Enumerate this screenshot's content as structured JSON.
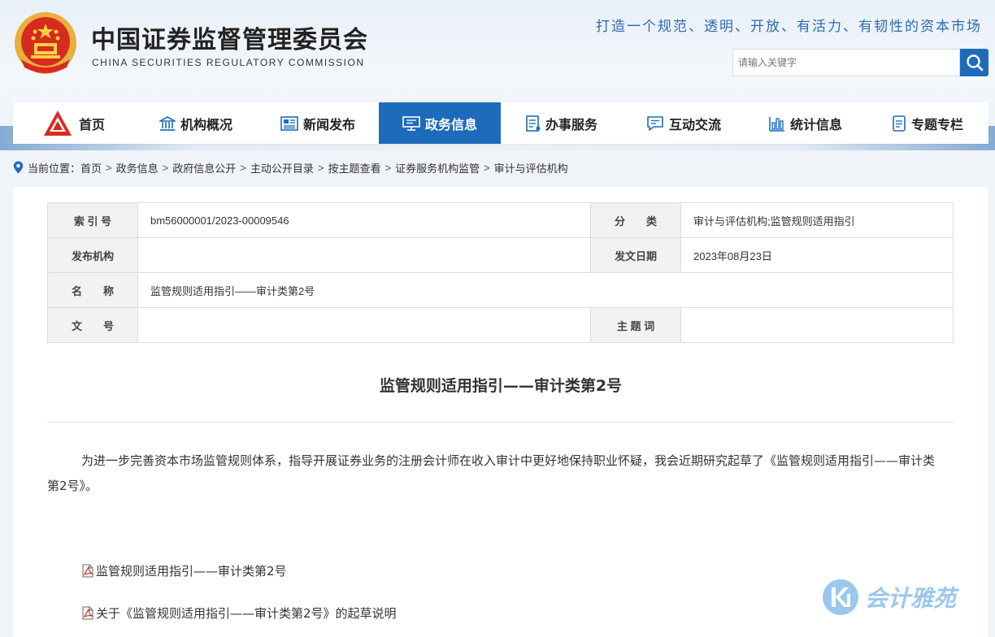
{
  "header": {
    "title": "中国证券监督管理委员会",
    "subtitle": "CHINA SECURITIES REGULATORY COMMISSION",
    "slogan": "打造一个规范、透明、开放、有活力、有韧性的资本市场",
    "search_placeholder": "请输入关键字"
  },
  "nav": {
    "items": [
      {
        "label": "首页",
        "icon": "csrc-logo-icon"
      },
      {
        "label": "机构概况",
        "icon": "building-icon"
      },
      {
        "label": "新闻发布",
        "icon": "newspaper-icon"
      },
      {
        "label": "政务信息",
        "icon": "monitor-icon",
        "active": true
      },
      {
        "label": "办事服务",
        "icon": "list-document-icon"
      },
      {
        "label": "互动交流",
        "icon": "chat-icon"
      },
      {
        "label": "统计信息",
        "icon": "bar-chart-icon"
      },
      {
        "label": "专题专栏",
        "icon": "document-icon"
      }
    ],
    "active_color": "#1f6bbb"
  },
  "breadcrumb": {
    "prefix": "当前位置：",
    "items": [
      "首页",
      "政务信息",
      "政府信息公开",
      "主动公开目录",
      "按主题查看",
      "证券服务机构监管",
      "审计与评估机构"
    ]
  },
  "meta": {
    "index_label": "索 引 号",
    "index_value": "bm56000001/2023-00009546",
    "category_label": "分　　类",
    "category_value": "审计与评估机构;监管规则适用指引",
    "issuer_label": "发布机构",
    "issuer_value": "",
    "date_label": "发文日期",
    "date_value": "2023年08月23日",
    "name_label": "名　　称",
    "name_value": "监管规则适用指引——审计类第2号",
    "docno_label": "文　　号",
    "docno_value": "",
    "keywords_label": "主 题 词",
    "keywords_value": ""
  },
  "article": {
    "title": "监管规则适用指引——审计类第2号",
    "body": "为进一步完善资本市场监管规则体系，指导开展证券业务的注册会计师在收入审计中更好地保持职业怀疑，我会近期研究起草了《监管规则适用指引——审计类第2号》。",
    "attachments": [
      "监管规则适用指引——审计类第2号",
      "关于《监管规则适用指引——审计类第2号》的起草说明"
    ]
  },
  "watermark": {
    "text": "会计雅苑"
  }
}
